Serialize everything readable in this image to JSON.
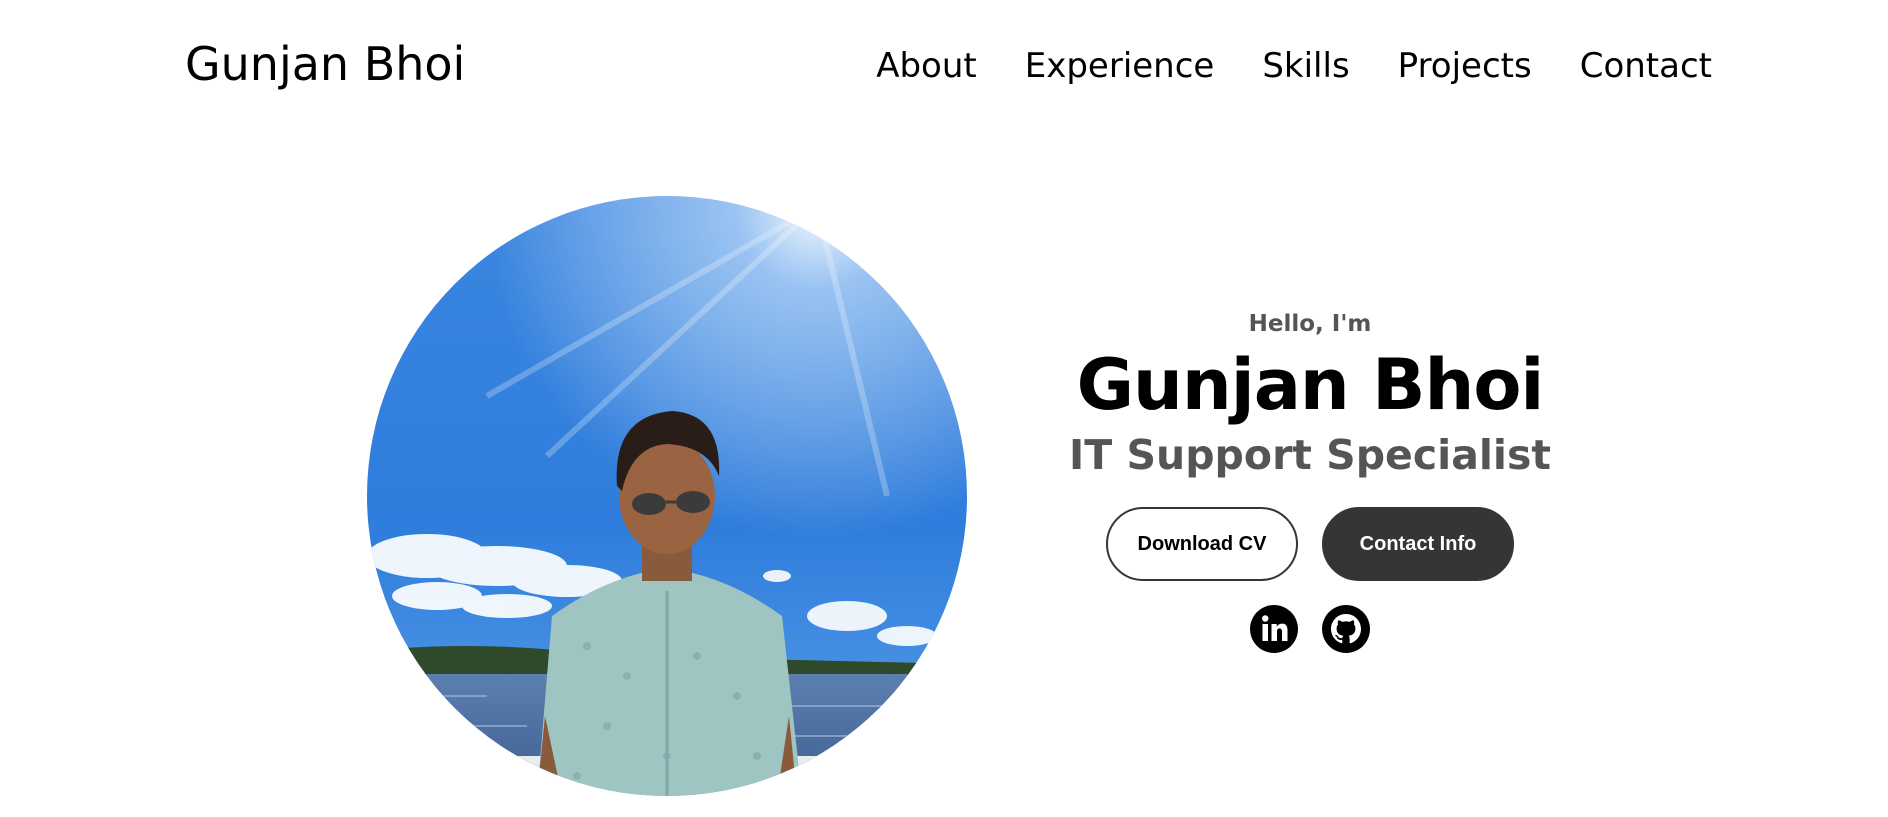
{
  "header": {
    "logo_text": "Gunjan Bhoi",
    "nav": [
      {
        "label": "About"
      },
      {
        "label": "Experience"
      },
      {
        "label": "Skills"
      },
      {
        "label": "Projects"
      },
      {
        "label": "Contact"
      }
    ]
  },
  "hero": {
    "greeting": "Hello, I'm",
    "name": "Gunjan Bhoi",
    "role": "IT Support Specialist",
    "buttons": {
      "download_cv": "Download CV",
      "contact_info": "Contact Info"
    },
    "socials": [
      {
        "icon": "linkedin-icon"
      },
      {
        "icon": "github-icon"
      }
    ]
  },
  "colors": {
    "text": "#000000",
    "muted_text": "#555555",
    "button_dark": "#353535",
    "background": "#ffffff"
  }
}
